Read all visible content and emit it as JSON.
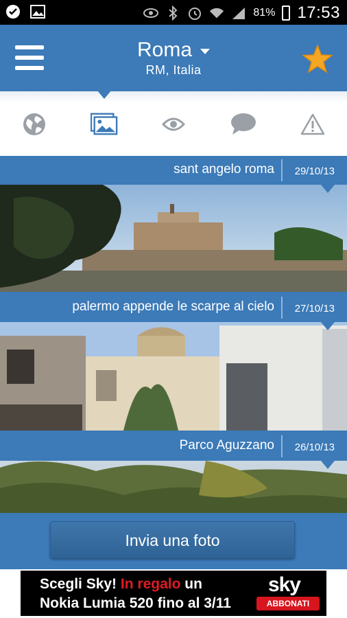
{
  "statusbar": {
    "battery": "81%",
    "time": "17:53"
  },
  "header": {
    "city": "Roma",
    "region": "RM, Italia"
  },
  "tabs": [
    {
      "name": "globe"
    },
    {
      "name": "photos",
      "active": true
    },
    {
      "name": "eye"
    },
    {
      "name": "comments"
    },
    {
      "name": "alerts"
    }
  ],
  "photos": [
    {
      "title": "sant angelo roma",
      "date": "29/10/13"
    },
    {
      "title": "palermo appende le scarpe al cielo",
      "date": "27/10/13"
    },
    {
      "title": "Parco Aguzzano",
      "date": "26/10/13"
    }
  ],
  "footer": {
    "send_label": "Invia una foto"
  },
  "ad": {
    "line1_a": "Scegli Sky!",
    "line1_b": "In regalo",
    "line1_c": "un",
    "line2": "Nokia Lumia 520 fino al 3/11",
    "brand": "sky",
    "cta": "ABBONATI"
  },
  "colors": {
    "accent": "#3c7ab8",
    "star": "#f5a623",
    "ad_red": "#e01b24"
  }
}
